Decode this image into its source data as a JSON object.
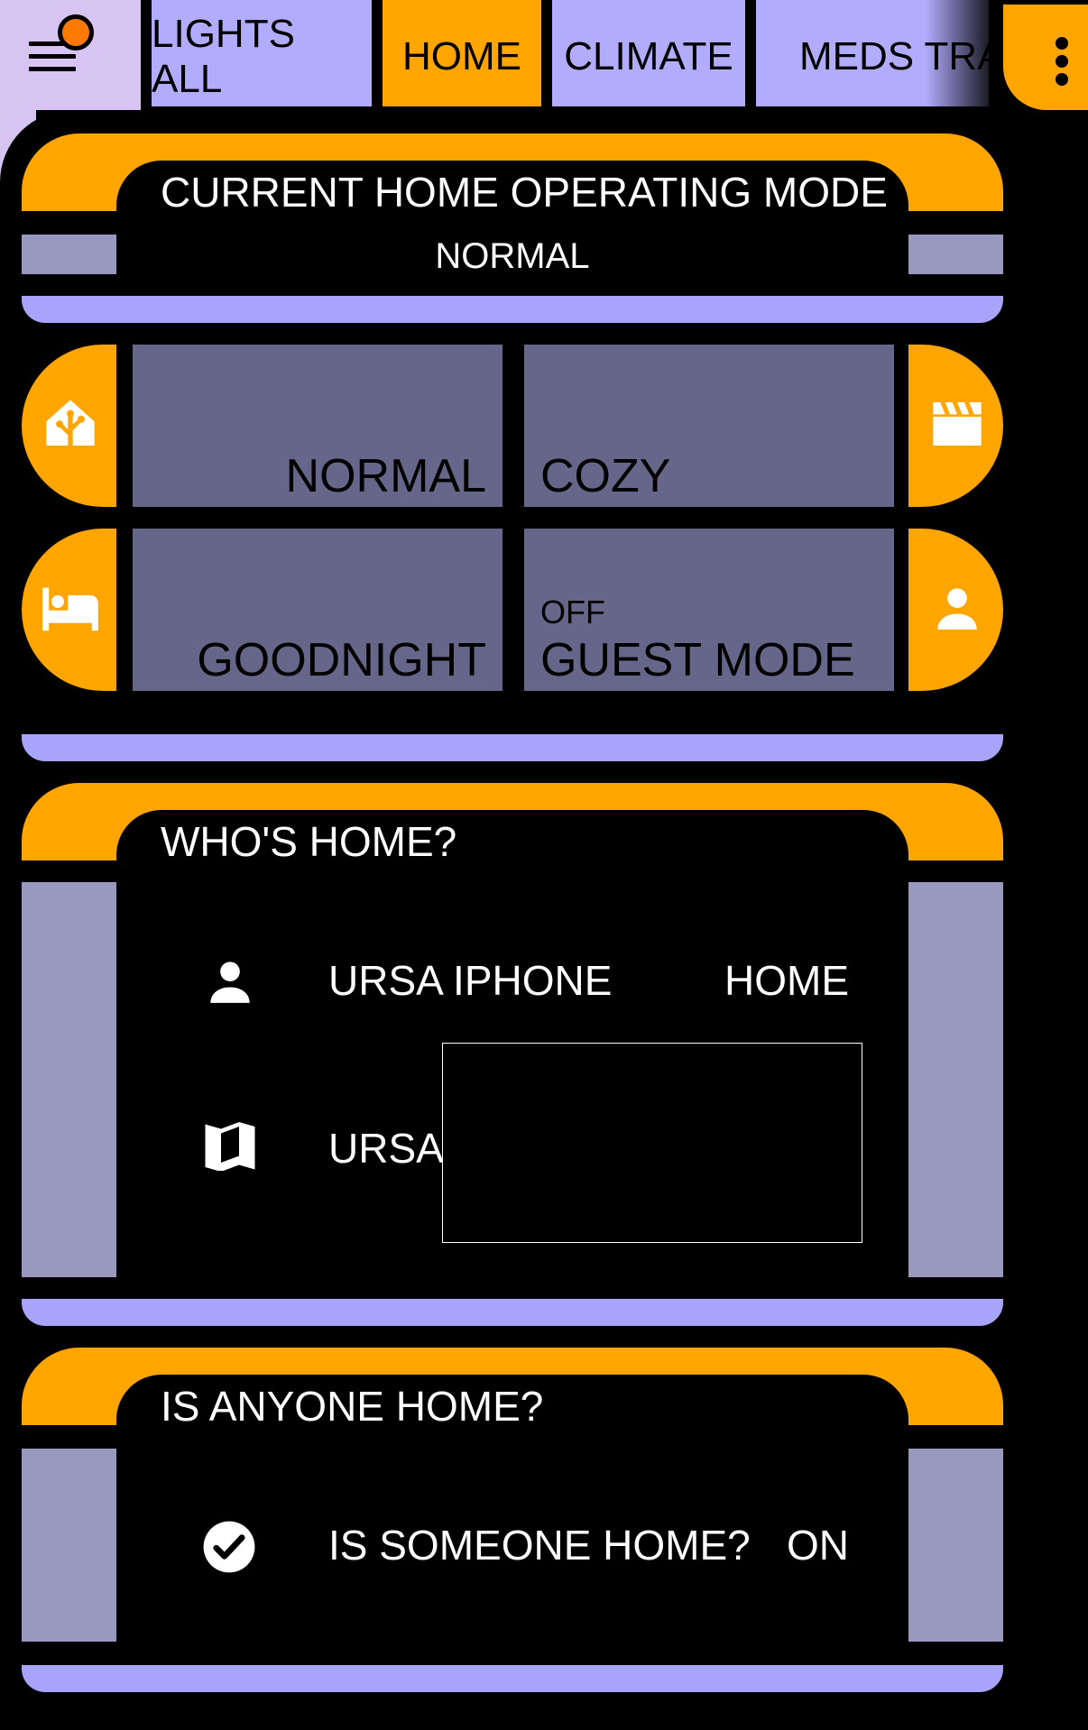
{
  "header": {
    "menu_icon": "menu-icon",
    "tabs": [
      {
        "label": "LIGHTS ALL",
        "active": false
      },
      {
        "label": "HOME",
        "active": true
      },
      {
        "label": "CLIMATE",
        "active": false
      },
      {
        "label": "MEDS TRACKIN",
        "active": false
      }
    ],
    "overflow_icon": "dots-vertical-icon"
  },
  "operating_mode_card": {
    "title": "CURRENT HOME OPERATING MODE",
    "value": "NORMAL"
  },
  "mode_buttons": {
    "left_icons": [
      "home-assistant-icon",
      "bed-icon"
    ],
    "right_icons": [
      "movie-clapper-icon",
      "person-icon"
    ],
    "tiles": [
      {
        "label": "NORMAL",
        "sub": ""
      },
      {
        "label": "COZY",
        "sub": ""
      },
      {
        "label": "GOODNIGHT",
        "sub": ""
      },
      {
        "label": "GUEST MODE",
        "sub": "OFF"
      }
    ]
  },
  "whos_home_card": {
    "title": "WHO'S HOME?",
    "rows": [
      {
        "icon": "person-icon",
        "name": "URSA IPHONE",
        "state": "HOME"
      },
      {
        "icon": "map-icon",
        "name": "URSA I..."
      }
    ]
  },
  "anyone_home_card": {
    "title": "IS ANYONE HOME?",
    "rows": [
      {
        "icon": "check-circle-icon",
        "name": "IS SOMEONE HOME?",
        "state": "ON"
      }
    ]
  },
  "colors": {
    "orange": "#ffa500",
    "lavender": "#b2acfd",
    "side_gray": "#9999bf",
    "tile_gray": "#66668a",
    "bottom_bar": "#a7a5fb",
    "menu_bg": "#d8c4f2",
    "menu_dot": "#ff7a00"
  }
}
